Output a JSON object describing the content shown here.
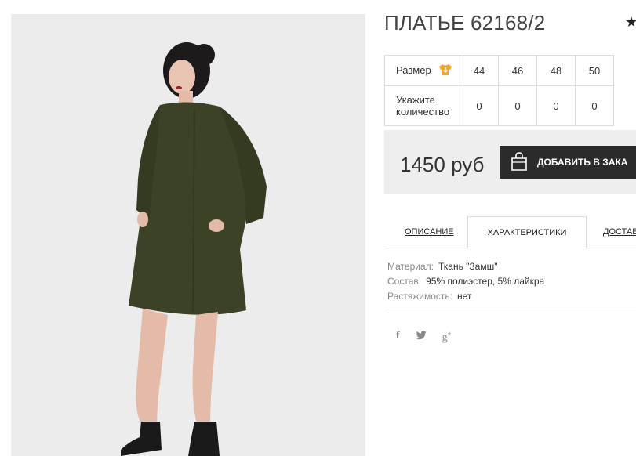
{
  "product": {
    "title": "ПЛАТЬЕ 62168/2"
  },
  "size_table": {
    "size_label": "Размер",
    "qty_label_1": "Укажите",
    "qty_label_2": "количество",
    "sizes": [
      "44",
      "46",
      "48",
      "50"
    ],
    "quantities": [
      "0",
      "0",
      "0",
      "0"
    ]
  },
  "price_block": {
    "price": "1450 руб",
    "add_button_label": "ДОБАВИТЬ В ЗАКА"
  },
  "tabs": [
    {
      "label": "ОПИСАНИЕ",
      "active": false
    },
    {
      "label": "ХАРАКТЕРИСТИКИ",
      "active": true
    },
    {
      "label": "ДОСТАВ",
      "active": false
    }
  ],
  "specs": [
    {
      "key": "Материал:",
      "value": "Ткань \"Замш\""
    },
    {
      "key": "Состав:",
      "value": "95% полиэстер, 5% лайкра"
    },
    {
      "key": "Растяжимость:",
      "value": "нет"
    }
  ],
  "icons": {
    "favorite": "star-icon",
    "size_chart": "shirt-icon",
    "cart": "shopping-bag-icon",
    "share": [
      "facebook-icon",
      "twitter-icon",
      "google-plus-icon"
    ]
  },
  "colors": {
    "button_bg": "#2b2b2b",
    "price_bg": "#eeeeee",
    "size_icon": "#f5a623",
    "dress": "#3b4226"
  }
}
